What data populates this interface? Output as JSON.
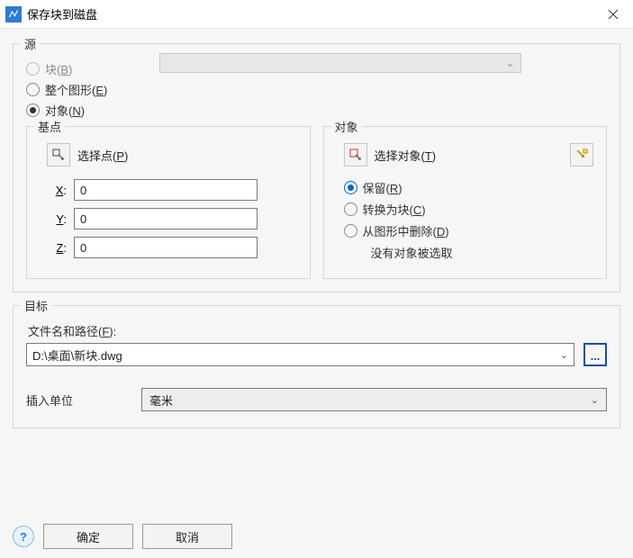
{
  "window": {
    "title": "保存块到磁盘"
  },
  "source": {
    "legend": "源",
    "options": {
      "block_label": "块(B)",
      "whole_label": "整个图形(E)",
      "object_label": "对象(N)"
    }
  },
  "basepoint": {
    "legend": "基点",
    "pick_label": "选择点(P)",
    "x_label": "X:",
    "y_label": "Y:",
    "z_label": "Z:",
    "x_value": "0",
    "y_value": "0",
    "z_value": "0"
  },
  "objects": {
    "legend": "对象",
    "pick_label": "选择对象(T)",
    "retain_label": "保留(R)",
    "convert_label": "转换为块(C)",
    "delete_label": "从图形中删除(D)",
    "status": "没有对象被选取"
  },
  "target": {
    "legend": "目标",
    "path_label": "文件名和路径(F):",
    "path_value": "D:\\桌面\\新块.dwg",
    "unit_label": "插入单位",
    "unit_value": "毫米"
  },
  "buttons": {
    "ok": "确定",
    "cancel": "取消",
    "browse": "..."
  }
}
